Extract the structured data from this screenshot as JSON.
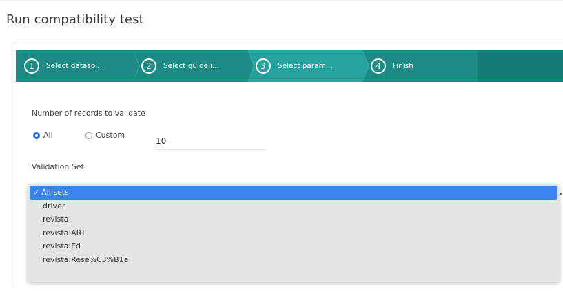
{
  "page": {
    "title": "Run compatibility test"
  },
  "wizard": {
    "steps": [
      {
        "num": "1",
        "label": "Select dataso..."
      },
      {
        "num": "2",
        "label": "Select guideli..."
      },
      {
        "num": "3",
        "label": "Select param...",
        "active": true
      },
      {
        "num": "4",
        "label": "Finish"
      }
    ],
    "colors": {
      "base": "#1d8a86",
      "active": "#26a39f"
    }
  },
  "records": {
    "label": "Number of records to validate",
    "options": [
      {
        "label": "All",
        "checked": true
      },
      {
        "label": "Custom",
        "checked": false
      }
    ],
    "custom_value": "10"
  },
  "validation": {
    "label": "Validation Set",
    "options": [
      "All sets",
      "driver",
      "revista",
      "revista:ART",
      "revista:Ed",
      "revista:Rese%C3%B1a"
    ],
    "selected": "All sets",
    "selected_check": "✓",
    "highlight_color": "#3a84f0"
  }
}
